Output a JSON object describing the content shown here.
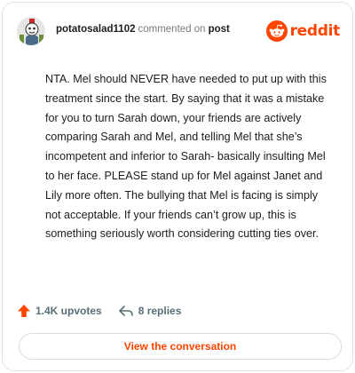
{
  "header": {
    "username": "potatosalad1102",
    "verb": "commented on",
    "target": "post",
    "brand": "reddit"
  },
  "comment": {
    "text": "NTA. Mel should NEVER have needed to put up with this treatment since the start. By saying that it was a mistake for you to turn Sarah down, your friends are actively comparing Sarah and Mel, and telling Mel that she’s incompetent and inferior to Sarah- basically insulting Mel to her face. PLEASE stand up for Mel against Janet and Lily more often. The bullying that Mel is facing is simply not acceptable. If your friends can’t grow up, this is something seriously worth considering cutting ties over."
  },
  "actions": {
    "upvotes": "1.4K upvotes",
    "replies": "8 replies"
  },
  "cta": {
    "label": "View the conversation"
  },
  "icons": {
    "avatar": "user-avatar",
    "logo": "reddit-logo-icon",
    "upvote": "upvote-arrow-icon",
    "reply": "reply-arrow-icon"
  },
  "colors": {
    "brand": "#ff4500",
    "muted": "#576f76",
    "border": "#e3e3e3"
  }
}
